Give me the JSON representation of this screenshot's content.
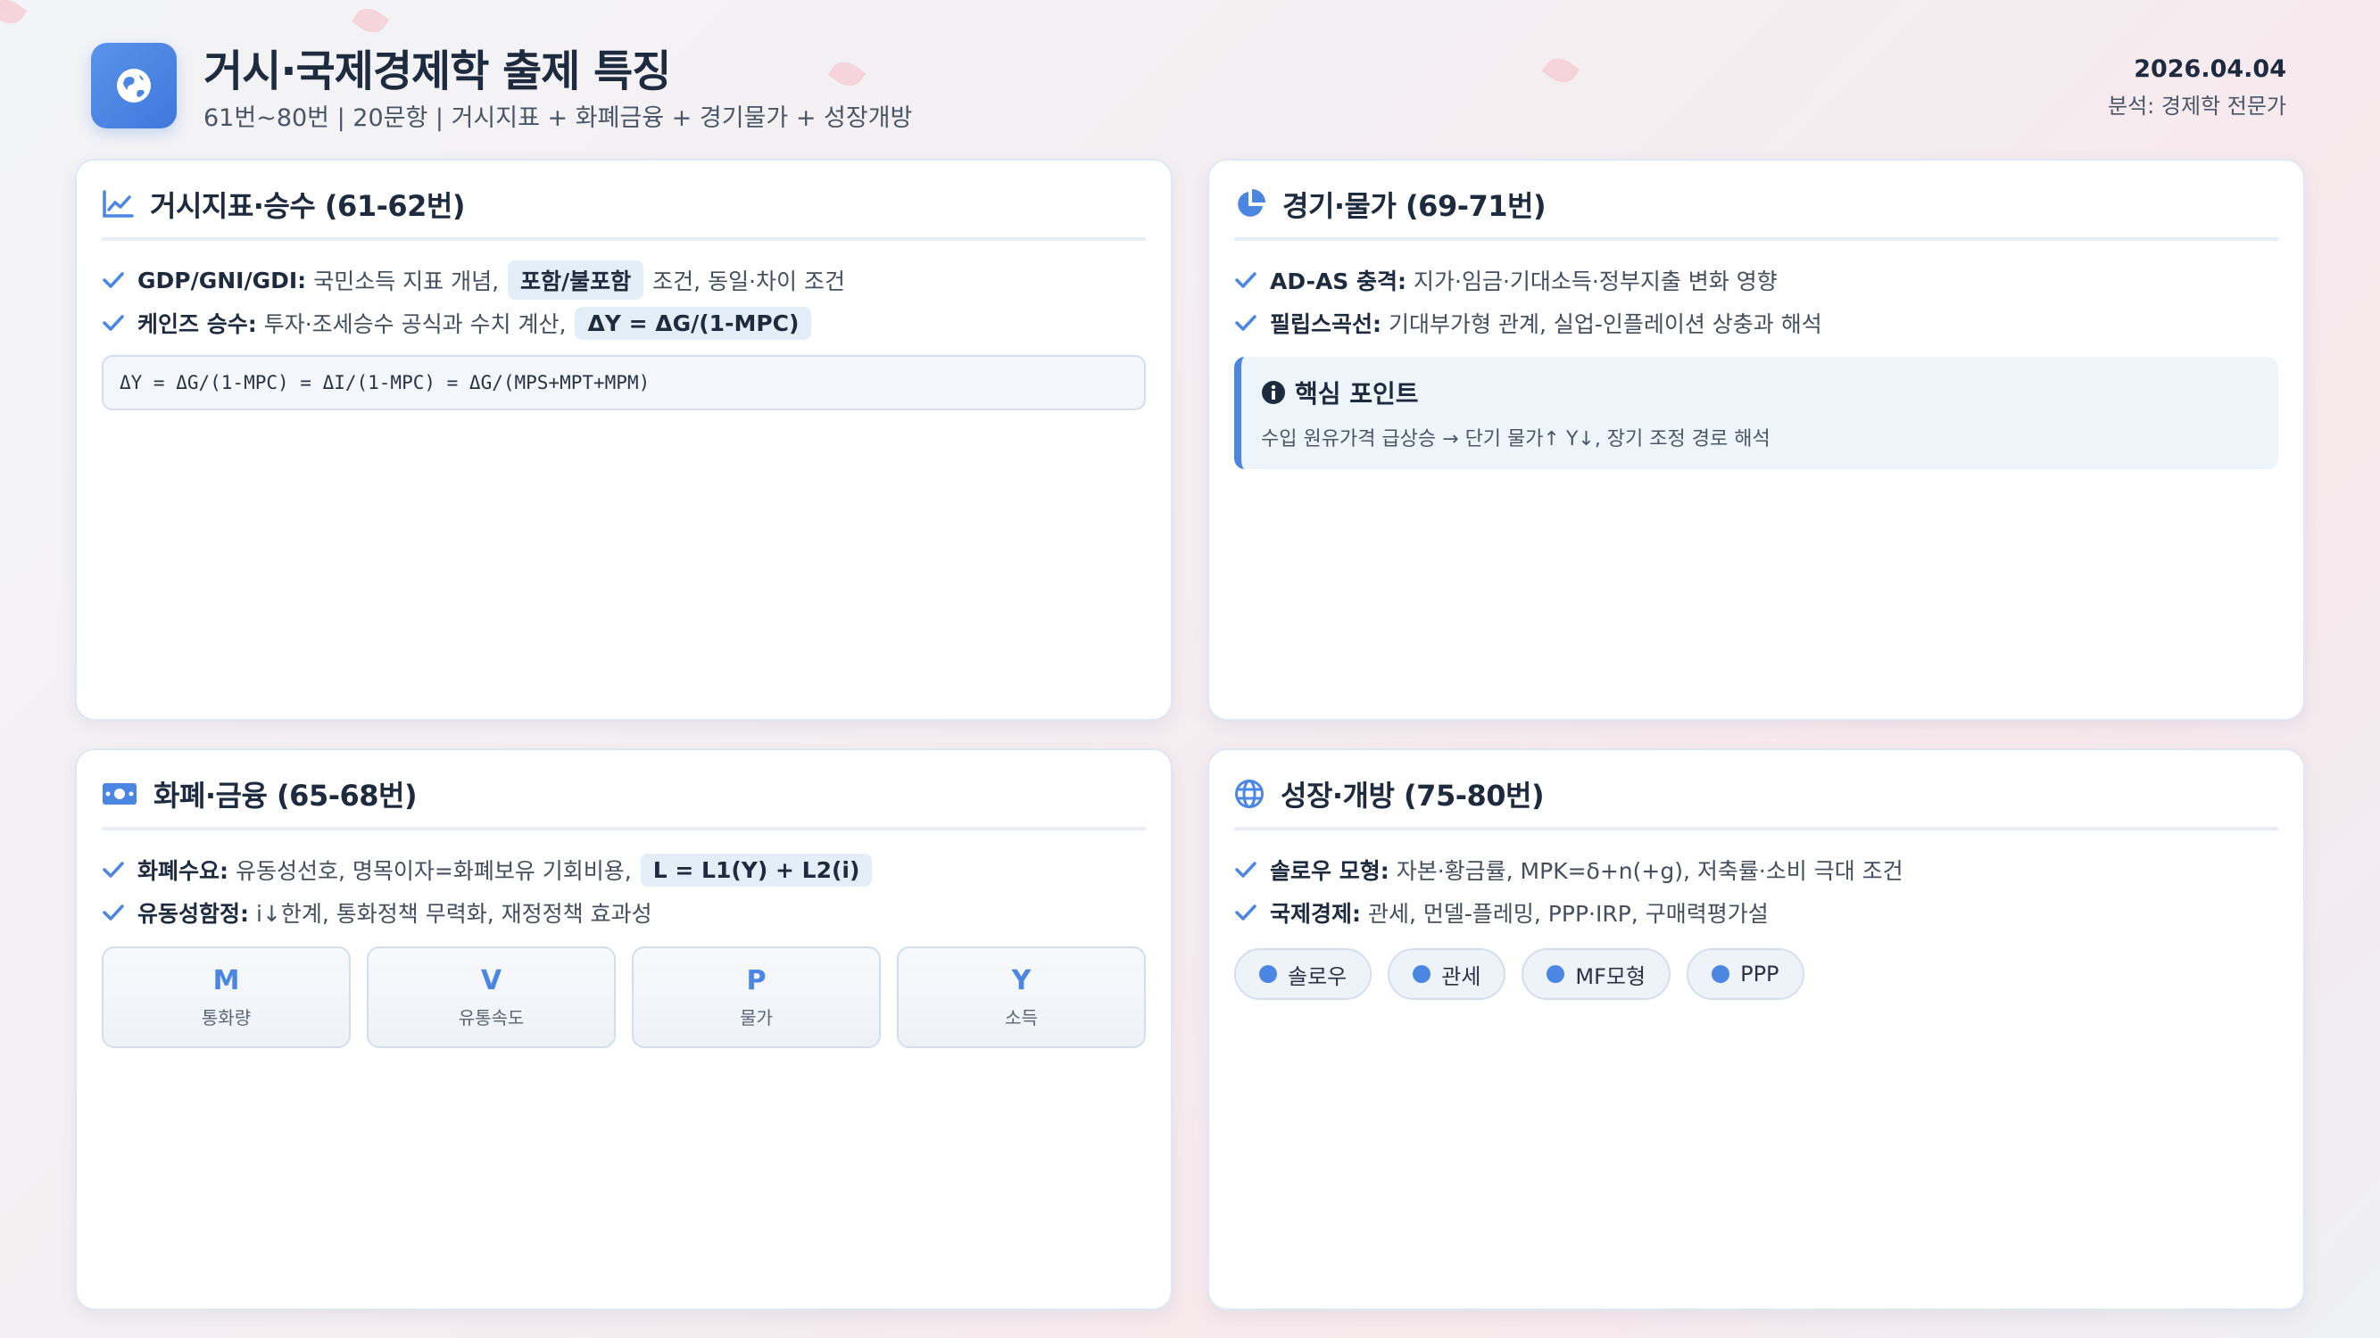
{
  "header": {
    "title": "거시·국제경제학 출제 특징",
    "subtitle": "61번~80번 | 20문항 | 거시지표 + 화폐금융 + 경기물가 + 성장개방",
    "date": "2026.04.04",
    "author": "분석: 경제학 전문가",
    "logo_icon": "globe-icon"
  },
  "colors": {
    "accent": "#4a86e2",
    "highlight_bg": "#e4eef8",
    "title": "#1e2b3f"
  },
  "cards": {
    "macro": {
      "title": "거시지표·승수 (61-62번)",
      "icon": "line-chart-icon",
      "items": [
        {
          "label": "GDP/GNI/GDI:",
          "pre": "국민소득 지표 개념,",
          "highlight": "포함/불포함",
          "post": "조건, 동일·차이 조건"
        },
        {
          "label": "케인즈 승수:",
          "pre": "투자·조세승수 공식과 수치 계산,",
          "highlight": "ΔY = ΔG/(1-MPC)"
        }
      ],
      "formula": "ΔY = ΔG/(1-MPC) = ΔI/(1-MPC) = ΔG/(MPS+MPT+MPM)"
    },
    "cycle": {
      "title": "경기·물가 (69-71번)",
      "icon": "pie-chart-icon",
      "items": [
        {
          "label": "AD-AS 충격:",
          "text": "지가·임금·기대소득·정부지출 변화 영향"
        },
        {
          "label": "필립스곡선:",
          "text": "기대부가형 관계, 실업-인플레이션 상충과 해석"
        }
      ],
      "keypoint": {
        "title": "핵심 포인트",
        "body": "수입 원유가격 급상승 → 단기 물가↑ Y↓, 장기 조정 경로 해석"
      }
    },
    "money": {
      "title": "화폐·금융 (65-68번)",
      "icon": "money-icon",
      "items": [
        {
          "label": "화폐수요:",
          "pre": "유동성선호, 명목이자=화폐보유 기회비용,",
          "highlight": "L = L1(Y) + L2(i)"
        },
        {
          "label": "유동성함정:",
          "text": "i↓한계, 통화정책 무력화, 재정정책 효과성"
        }
      ],
      "boxes": [
        {
          "sym": "M",
          "label": "통화량"
        },
        {
          "sym": "V",
          "label": "유통속도"
        },
        {
          "sym": "P",
          "label": "물가"
        },
        {
          "sym": "Y",
          "label": "소득"
        }
      ]
    },
    "growth": {
      "title": "성장·개방 (75-80번)",
      "icon": "globe-icon",
      "items": [
        {
          "label": "솔로우 모형:",
          "text": "자본·황금률, MPK=δ+n(+g), 저축률·소비 극대 조건"
        },
        {
          "label": "국제경제:",
          "text": "관세, 먼델-플레밍, PPP·IRP, 구매력평가설"
        }
      ],
      "pills": [
        "솔로우",
        "관세",
        "MF모형",
        "PPP"
      ]
    }
  }
}
